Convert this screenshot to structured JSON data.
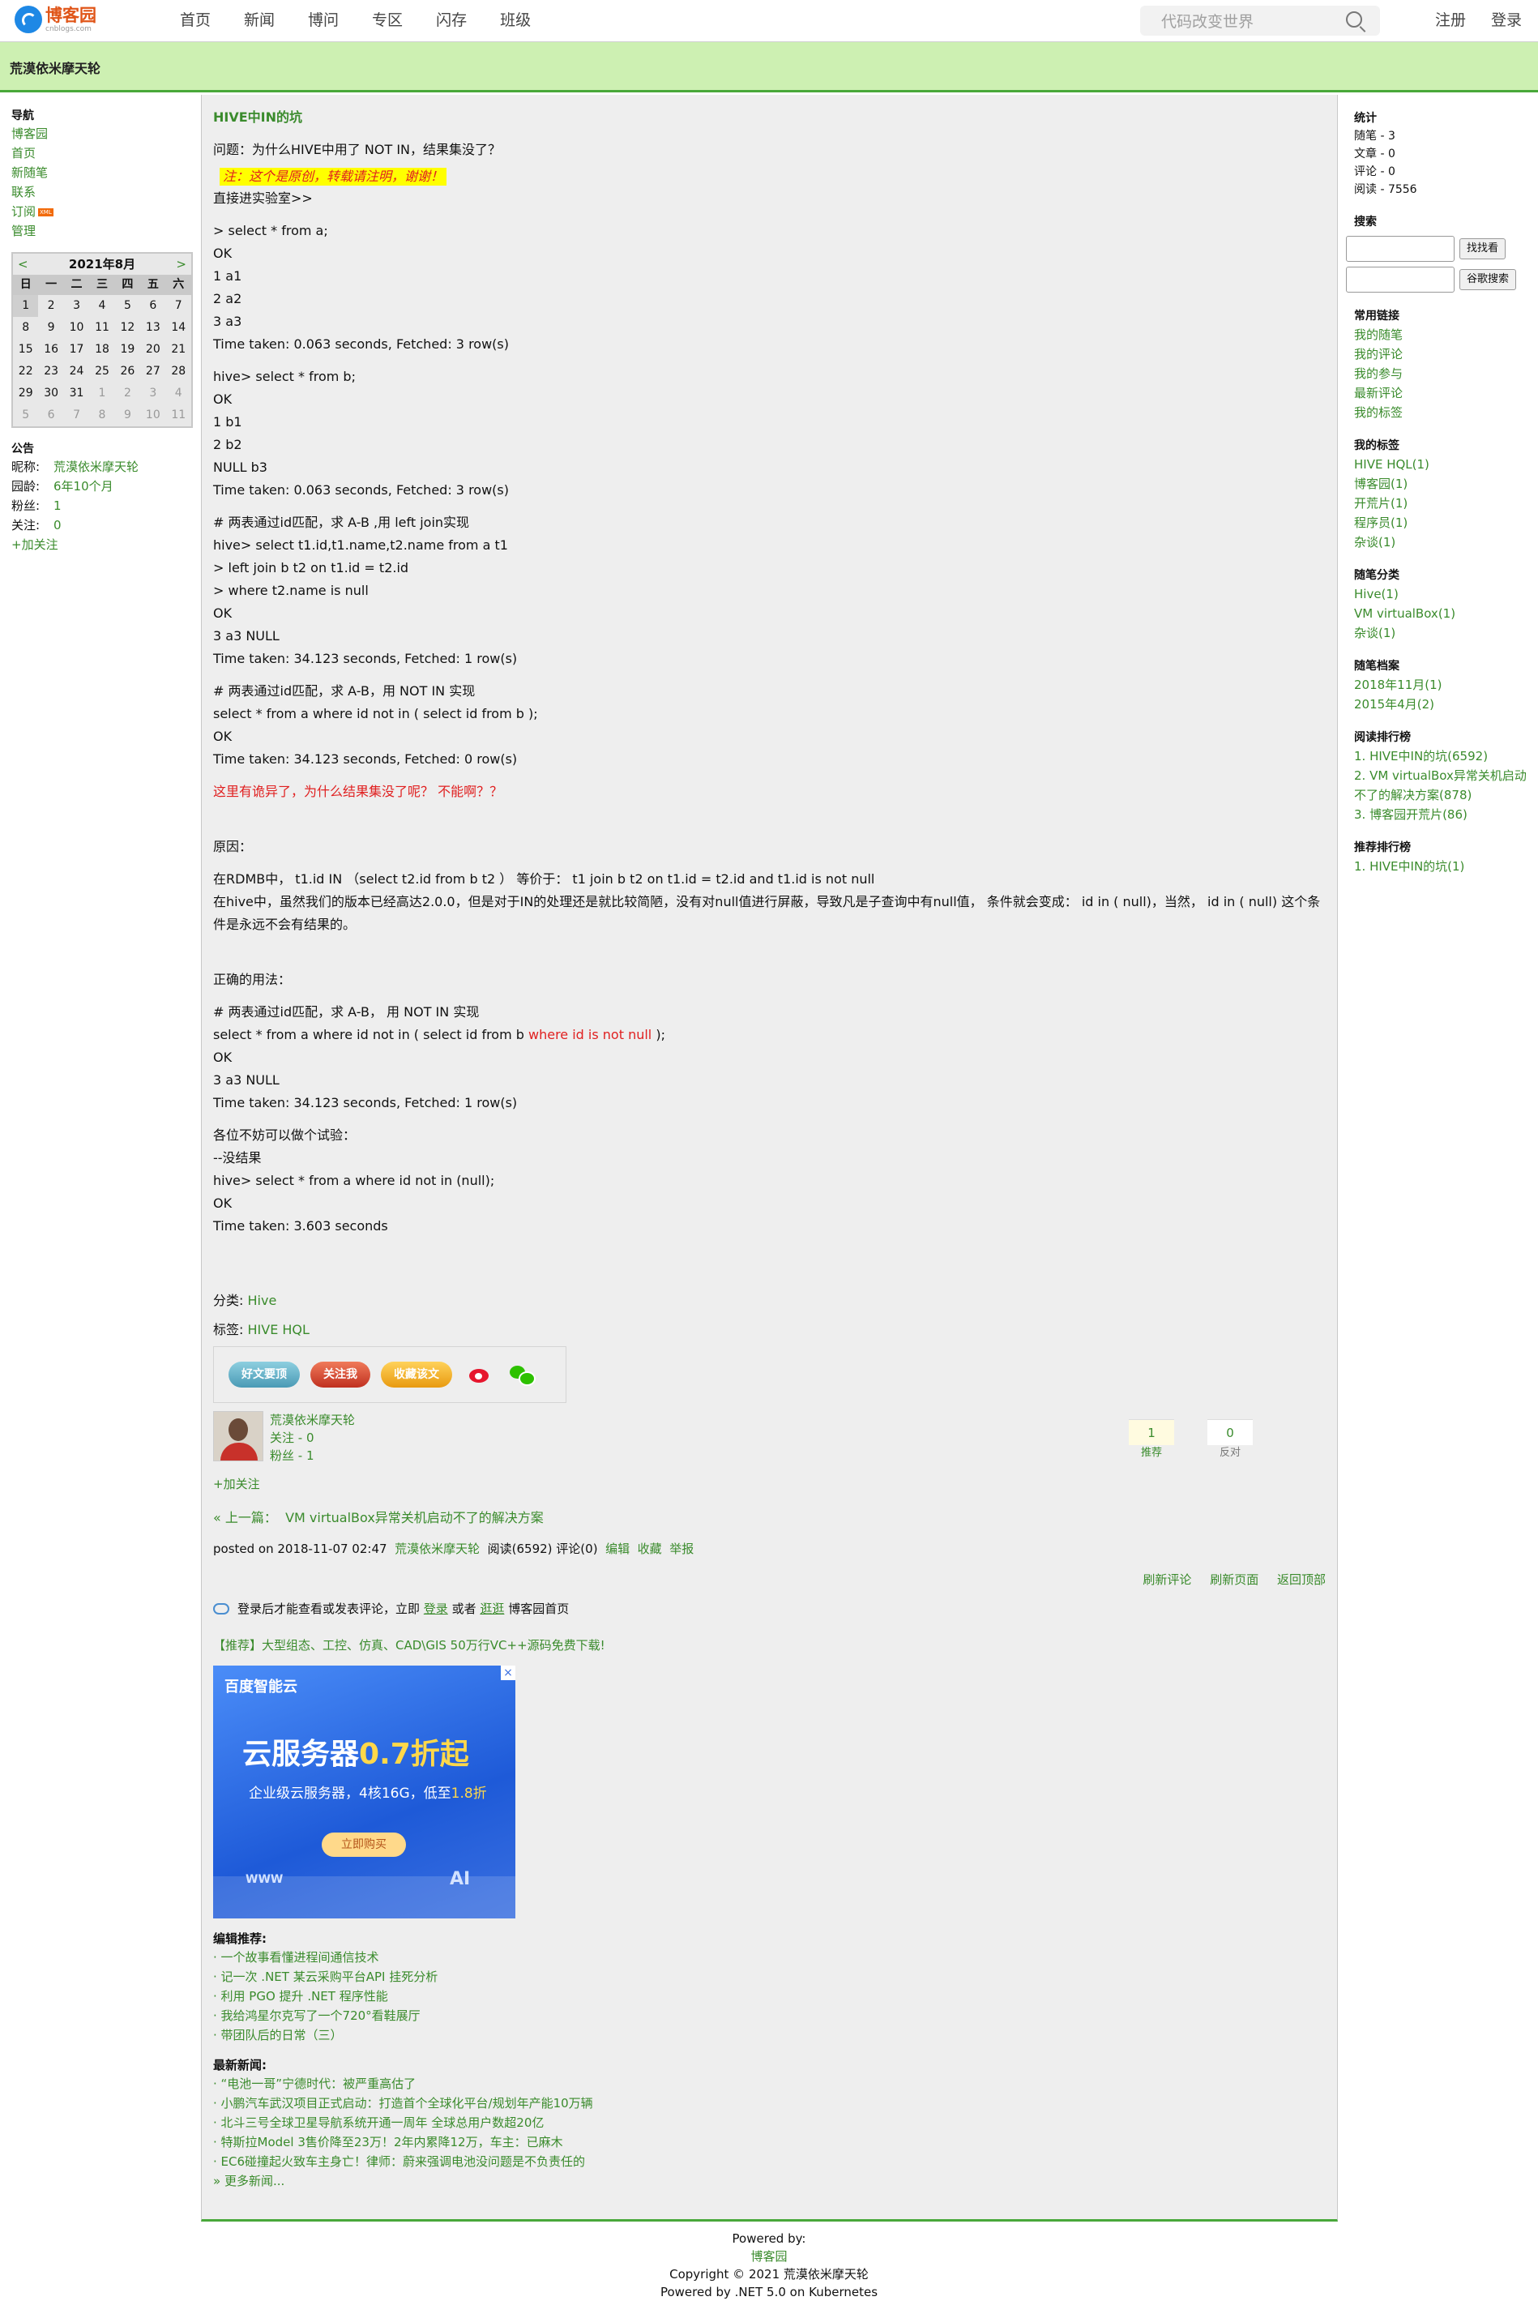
{
  "topbar": {
    "logo_text": "博客园",
    "logo_sub": "cnblogs.com",
    "nav": [
      "首页",
      "新闻",
      "博问",
      "专区",
      "闪存",
      "班级"
    ],
    "search_placeholder": "代码改变世界",
    "register": "注册",
    "login": "登录"
  },
  "header": {
    "blog_title": "荒漠依米摩天轮"
  },
  "left": {
    "nav_title": "导航",
    "nav_items": [
      "博客园",
      "首页",
      "新随笔",
      "联系",
      "订阅",
      "管理"
    ],
    "rss_badge": "XML",
    "calendar": {
      "prev": "<",
      "title": "2021年8月",
      "next": ">",
      "weekdays": [
        "日",
        "一",
        "二",
        "三",
        "四",
        "五",
        "六"
      ],
      "rows": [
        [
          "1",
          "2",
          "3",
          "4",
          "5",
          "6",
          "7"
        ],
        [
          "8",
          "9",
          "10",
          "11",
          "12",
          "13",
          "14"
        ],
        [
          "15",
          "16",
          "17",
          "18",
          "19",
          "20",
          "21"
        ],
        [
          "22",
          "23",
          "24",
          "25",
          "26",
          "27",
          "28"
        ],
        [
          "29",
          "30",
          "31",
          "1",
          "2",
          "3",
          "4"
        ],
        [
          "5",
          "6",
          "7",
          "8",
          "9",
          "10",
          "11"
        ]
      ]
    },
    "notice_title": "公告",
    "profile": [
      {
        "k": "昵称:",
        "v": "荒漠依米摩天轮"
      },
      {
        "k": "园龄:",
        "v": "6年10个月"
      },
      {
        "k": "粉丝:",
        "v": "1"
      },
      {
        "k": "关注:",
        "v": "0"
      }
    ],
    "follow": "+加关注"
  },
  "post": {
    "title": "HIVE中IN的坑",
    "question": "问题：为什么HIVE中用了 NOT IN，结果集没了？",
    "warning": "注：这个是原创，转载请注明，谢谢！",
    "intro": "直接进实验室>>",
    "block1": [
      "> select * from a;",
      "OK",
      "1 a1",
      "2 a2",
      "3 a3",
      "Time taken: 0.063 seconds, Fetched: 3 row(s)"
    ],
    "block2": [
      "hive> select * from b;",
      "OK",
      "1 b1",
      "2 b2",
      "NULL b3",
      "Time taken: 0.063 seconds, Fetched: 3 row(s)"
    ],
    "block3": [
      "# 两表通过id匹配，求 A-B ,用 left join实现",
      "hive> select t1.id,t1.name,t2.name from a t1",
      "> left join b t2 on t1.id = t2.id",
      "> where t2.name is null",
      "OK",
      "3 a3 NULL",
      "Time taken: 34.123 seconds, Fetched: 1 row(s)"
    ],
    "block4": [
      "# 两表通过id匹配，求 A-B，用 NOT IN 实现",
      "select * from a where id not in ( select id from b );",
      "OK",
      "Time taken: 34.123 seconds, Fetched: 0 row(s)"
    ],
    "odd": "这里有诡异了，为什么结果集没了呢？ 不能啊？？",
    "reason_title": "原因：",
    "reason1": "在RDMB中， t1.id IN （select t2.id from b t2 ） 等价于： t1 join b t2 on t1.id = t2.id and t1.id is not null",
    "reason2": "在hive中，虽然我们的版本已经高达2.0.0，但是对于IN的处理还是就比较简陋，没有对null值进行屏蔽，导致凡是子查询中有null值， 条件就会变成： id in ( null)，当然， id in ( null) 这个条件是永远不会有结果的。",
    "correct_title": "正确的用法：",
    "correct_comment": "# 两表通过id匹配，求 A-B， 用 NOT IN 实现",
    "correct_sql_a": "select * from a where id not in ( select id from b ",
    "correct_sql_red": "where id is not null",
    "correct_sql_b": " );",
    "correct_rest": [
      "OK",
      "3 a3 NULL",
      "Time taken: 34.123 seconds, Fetched: 1 row(s)"
    ],
    "try_block": [
      "各位不妨可以做个试验：",
      "--没结果",
      "hive> select * from a where id not in (null);",
      "OK",
      "Time taken: 3.603 seconds"
    ],
    "category_label": "分类:",
    "category": "Hive",
    "tag_label": "标签:",
    "tag": "HIVE HQL",
    "share_buttons": [
      "好文要顶",
      "关注我",
      "收藏该文"
    ],
    "author": {
      "name": "荒漠依米摩天轮",
      "follow": "关注 - 0",
      "fans": "粉丝 - 1",
      "add": "+加关注"
    },
    "digg": {
      "up": "1",
      "up_label": "推荐",
      "down": "0",
      "down_label": "反对"
    },
    "prev_label": "« 上一篇：",
    "prev_title": "VM virtualBox异常关机启动不了的解决方案",
    "posted": "posted on 2018-11-07 02:47",
    "posted_author": "荒漠依米摩天轮",
    "posted_stats": "阅读(6592) 评论(0)",
    "posted_links": [
      "编辑",
      "收藏",
      "举报"
    ],
    "comment_links": [
      "刷新评论",
      "刷新页面",
      "返回顶部"
    ],
    "login_a": "登录后才能查看或发表评论，立即",
    "login_link": "登录",
    "login_or": "或者",
    "login_link2": "逛逛",
    "login_b": "博客园首页",
    "promo": "【推荐】大型组态、工控、仿真、CAD\\GIS 50万行VC++源码免费下载!"
  },
  "ad": {
    "close": "×",
    "brand": "百度智能云",
    "headline_a": "云服务器",
    "headline_b": "0.7折起",
    "sub_a": "企业级云服务器，4核16G，低至",
    "sub_b": "1.8折",
    "buy": "立即购买",
    "w1": "WWW",
    "w2": "AI"
  },
  "editor_pick": {
    "title": "编辑推荐:",
    "items": [
      "· 一个故事看懂进程间通信技术",
      "· 记一次 .NET 某云采购平台API 挂死分析",
      "· 利用 PGO 提升 .NET 程序性能",
      "· 我给鸿星尔克写了一个720°看鞋展厅",
      "· 带团队后的日常（三）"
    ]
  },
  "news": {
    "title": "最新新闻:",
    "items": [
      "· “电池一哥”宁德时代：被严重高估了",
      "· 小鹏汽车武汉项目正式启动：打造首个全球化平台/规划年产能10万辆",
      "· 北斗三号全球卫星导航系统开通一周年 全球总用户数超20亿",
      "· 特斯拉Model 3售价降至23万！2年内累降12万，车主：已麻木",
      "· EC6碰撞起火致车主身亡！律师：蔚来强调电池没问题是不负责任的"
    ],
    "more": "» 更多新闻..."
  },
  "right": {
    "stats_title": "统计",
    "stats": [
      "随笔 - 3",
      "文章 - 0",
      "评论 - 0",
      "阅读 - 7556"
    ],
    "search_title": "搜索",
    "search_btn1": "找找看",
    "search_btn2": "谷歌搜索",
    "links_title": "常用链接",
    "links": [
      "我的随笔",
      "我的评论",
      "我的参与",
      "最新评论",
      "我的标签"
    ],
    "tags_title": "我的标签",
    "tags": [
      "HIVE HQL(1)",
      "博客园(1)",
      "开荒片(1)",
      "程序员(1)",
      "杂谈(1)"
    ],
    "cats_title": "随笔分类",
    "cats": [
      "Hive(1)",
      "VM virtualBox(1)",
      "杂谈(1)"
    ],
    "archive_title": "随笔档案",
    "archive": [
      "2018年11月(1)",
      "2015年4月(2)"
    ],
    "read_title": "阅读排行榜",
    "read": [
      "1. HIVE中IN的坑(6592)",
      "2. VM virtualBox异常关机启动",
      "不了的解决方案(878)",
      "3. 博客园开荒片(86)"
    ],
    "rec_title": "推荐排行榜",
    "rec": [
      "1. HIVE中IN的坑(1)"
    ]
  },
  "footer": {
    "powered": "Powered by:",
    "site": "博客园",
    "copyright": "Copyright © 2021 荒漠依米摩天轮",
    "net": "Powered by .NET 5.0 on Kubernetes"
  }
}
